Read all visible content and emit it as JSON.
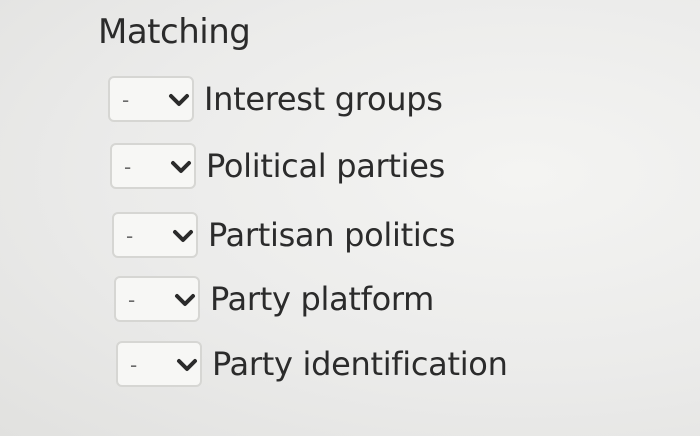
{
  "heading": "Matching",
  "rows": [
    {
      "selected": "-",
      "term": "Interest groups"
    },
    {
      "selected": "-",
      "term": "Political parties"
    },
    {
      "selected": "-",
      "term": "Partisan politics"
    },
    {
      "selected": "-",
      "term": "Party platform"
    },
    {
      "selected": "-",
      "term": "Party identification"
    }
  ],
  "icons": {
    "dropdown": "chevron-down-icon"
  },
  "colors": {
    "text": "#2b2b2b",
    "select_border": "#d6d6d3",
    "background": "#ebebea"
  }
}
